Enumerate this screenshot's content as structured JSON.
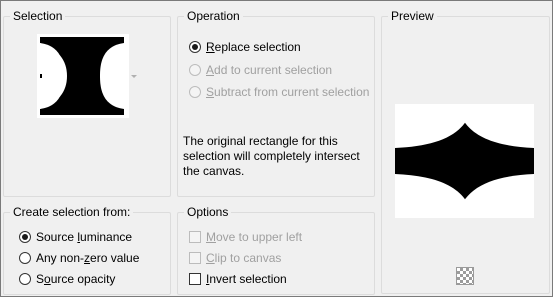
{
  "selection": {
    "title": "Selection"
  },
  "operation": {
    "title": "Operation",
    "options": [
      {
        "label_pre": "",
        "label_u": "R",
        "label_post": "eplace selection",
        "checked": true,
        "enabled": true
      },
      {
        "label_pre": "",
        "label_u": "A",
        "label_post": "dd to current selection",
        "checked": false,
        "enabled": false
      },
      {
        "label_pre": "",
        "label_u": "S",
        "label_post": "ubtract from current selection",
        "checked": false,
        "enabled": false
      }
    ],
    "note": "The original rectangle for this selection will completely intersect the canvas."
  },
  "preview": {
    "title": "Preview",
    "icon": "checkerboard-icon"
  },
  "create_from": {
    "title": "Create selection from:",
    "options": [
      {
        "label_pre": "Source ",
        "label_u": "l",
        "label_post": "uminance",
        "checked": true
      },
      {
        "label_pre": "Any non-",
        "label_u": "z",
        "label_post": "ero value",
        "checked": false
      },
      {
        "label_pre": "S",
        "label_u": "o",
        "label_post": "urce opacity",
        "checked": false
      }
    ]
  },
  "options": {
    "title": "Options",
    "items": [
      {
        "label_pre": "",
        "label_u": "M",
        "label_post": "ove to upper left",
        "checked": false,
        "enabled": false
      },
      {
        "label_pre": "",
        "label_u": "C",
        "label_post": "lip to canvas",
        "checked": false,
        "enabled": false
      },
      {
        "label_pre": "",
        "label_u": "I",
        "label_post": "nvert selection",
        "checked": false,
        "enabled": true
      }
    ]
  }
}
